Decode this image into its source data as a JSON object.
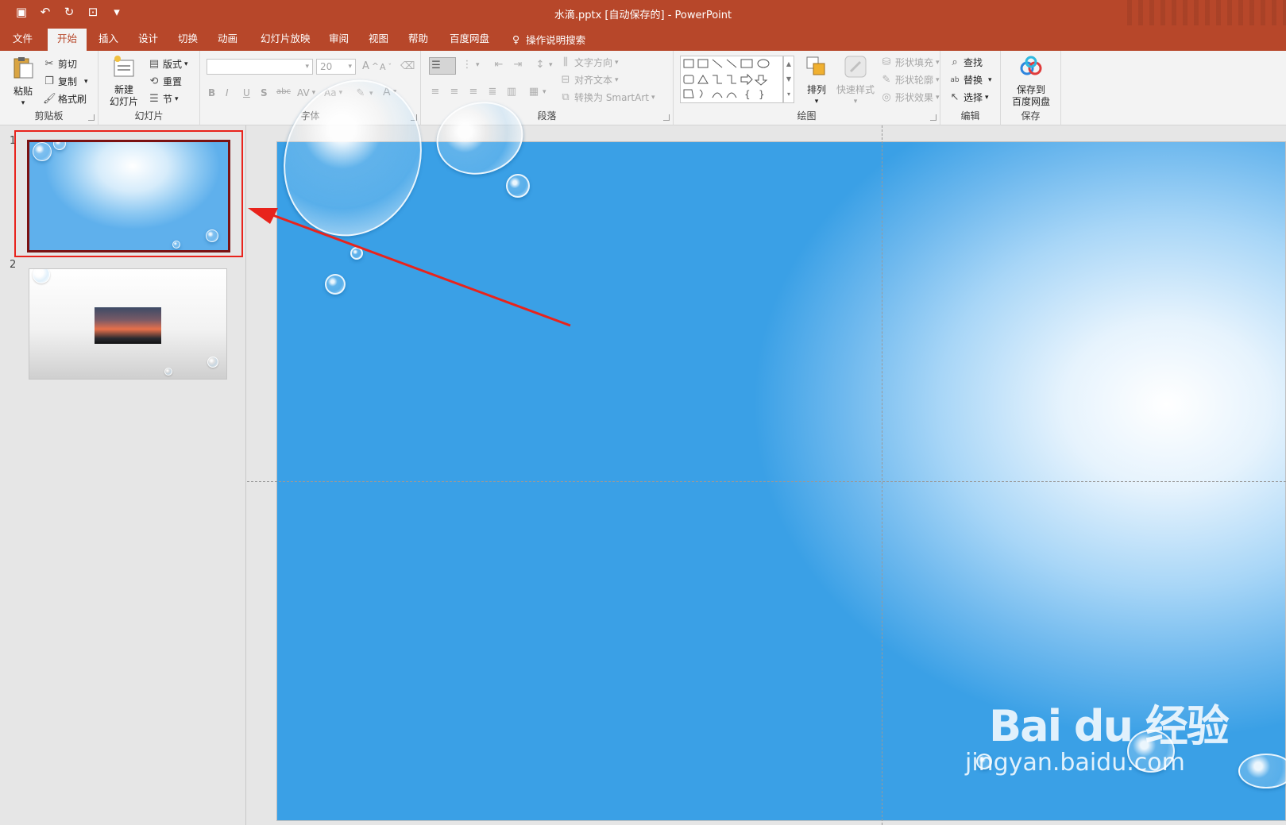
{
  "window": {
    "title": "水滴.pptx [自动保存的]  -  PowerPoint"
  },
  "qat": {
    "save": "save-icon",
    "undo": "undo-icon",
    "redo": "redo-icon",
    "presenter": "presenter-icon",
    "more": "more-icon"
  },
  "tabs": [
    "文件",
    "开始",
    "插入",
    "设计",
    "切换",
    "动画",
    "幻灯片放映",
    "审阅",
    "视图",
    "帮助",
    "百度网盘"
  ],
  "active_tab": "开始",
  "tell_me": "操作说明搜索",
  "ribbon": {
    "clipboard": {
      "paste": "粘贴",
      "cut": "剪切",
      "copy": "复制",
      "format_painter": "格式刷",
      "label": "剪贴板"
    },
    "slides": {
      "new_slide_line1": "新建",
      "new_slide_line2": "幻灯片",
      "layout": "版式",
      "reset": "重置",
      "section": "节",
      "label": "幻灯片"
    },
    "font": {
      "font_size": "20",
      "bold": "B",
      "italic": "I",
      "underline": "U",
      "shadow": "S",
      "strike": "abc",
      "spacing": "AV",
      "case": "Aa",
      "color": "A",
      "grow": "A",
      "shrink": "A",
      "label": "字体"
    },
    "paragraph": {
      "text_direction": "文字方向",
      "align_text": "对齐文本",
      "smartart": "转换为 SmartArt",
      "label": "段落"
    },
    "drawing": {
      "arrange": "排列",
      "quick_styles": "快速样式",
      "shape_fill": "形状填充",
      "shape_outline": "形状轮廓",
      "shape_effects": "形状效果",
      "label": "绘图"
    },
    "editing": {
      "find": "查找",
      "replace": "替换",
      "select": "选择",
      "label": "编辑"
    },
    "save": {
      "save_to_line1": "保存到",
      "save_to_line2": "百度网盘",
      "label": "保存"
    }
  },
  "thumbnails": [
    {
      "number": "1",
      "selected": true
    },
    {
      "number": "2",
      "selected": false
    }
  ],
  "watermark": {
    "line1": "Bai du 经验",
    "line2": "jingyan.baidu.com"
  },
  "colors": {
    "accent": "#b7472a",
    "ribbon_bg": "#f3f3f3",
    "highlight_box": "#e8231c",
    "selected_border": "#7b1212"
  }
}
